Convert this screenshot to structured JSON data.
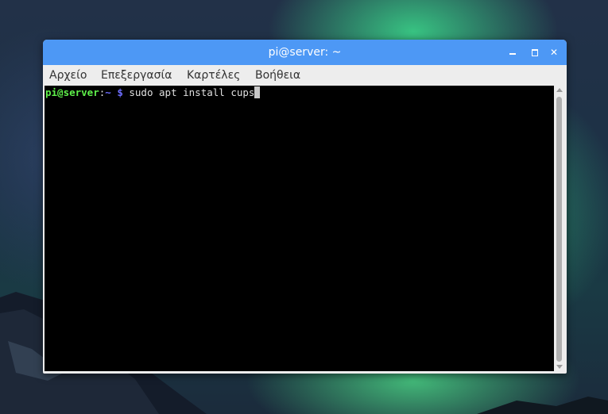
{
  "window": {
    "title": "pi@server: ~",
    "minimize_icon": "minimize-icon",
    "maximize_icon": "maximize-icon",
    "close_icon": "close-icon",
    "close_glyph": "✕",
    "titlebar_color": "#4d98f5"
  },
  "menubar": {
    "items": [
      {
        "label": "Αρχείο"
      },
      {
        "label": "Επεξεργασία"
      },
      {
        "label": "Καρτέλες"
      },
      {
        "label": "Βοήθεια"
      }
    ]
  },
  "terminal": {
    "prompt_user_host": "pi@server",
    "prompt_separator": ":",
    "prompt_path": "~",
    "prompt_symbol": " $",
    "command": " sudo apt install cups",
    "colors": {
      "background": "#000000",
      "user_host": "#5ef04a",
      "path": "#6d6dff",
      "text": "#e0e0e0"
    }
  }
}
